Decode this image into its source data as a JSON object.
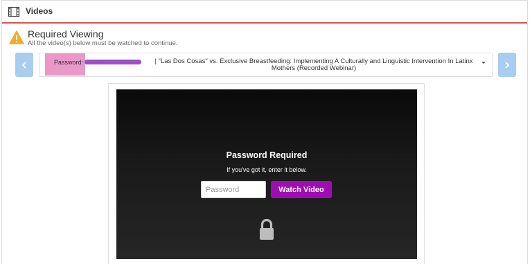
{
  "header": {
    "title": "Videos",
    "icon": "film-icon"
  },
  "notice": {
    "icon": "warning-icon",
    "title": "Required Viewing",
    "subtitle": "All the video(s) below must be watched to continue."
  },
  "video_select": {
    "password_label": "Password:",
    "selected_title": "| \"Las Dos Cosas\" vs. Exclusive Breastfeeding: Implementing A Culturally and Linguistic Intervention In Latinx Mothers (Recorded Webinar)"
  },
  "player": {
    "heading": "Password Required",
    "hint": "If you've got it, enter it below.",
    "input_placeholder": "Password",
    "submit_label": "Watch Video"
  },
  "colors": {
    "header_rule": "#d9534f",
    "nav_button": "#a8cdf0",
    "watch_button": "#a00cb3",
    "password_highlight": "#e88fc2",
    "redaction": "#9c4fc7",
    "warning": "#f0ad2b"
  }
}
